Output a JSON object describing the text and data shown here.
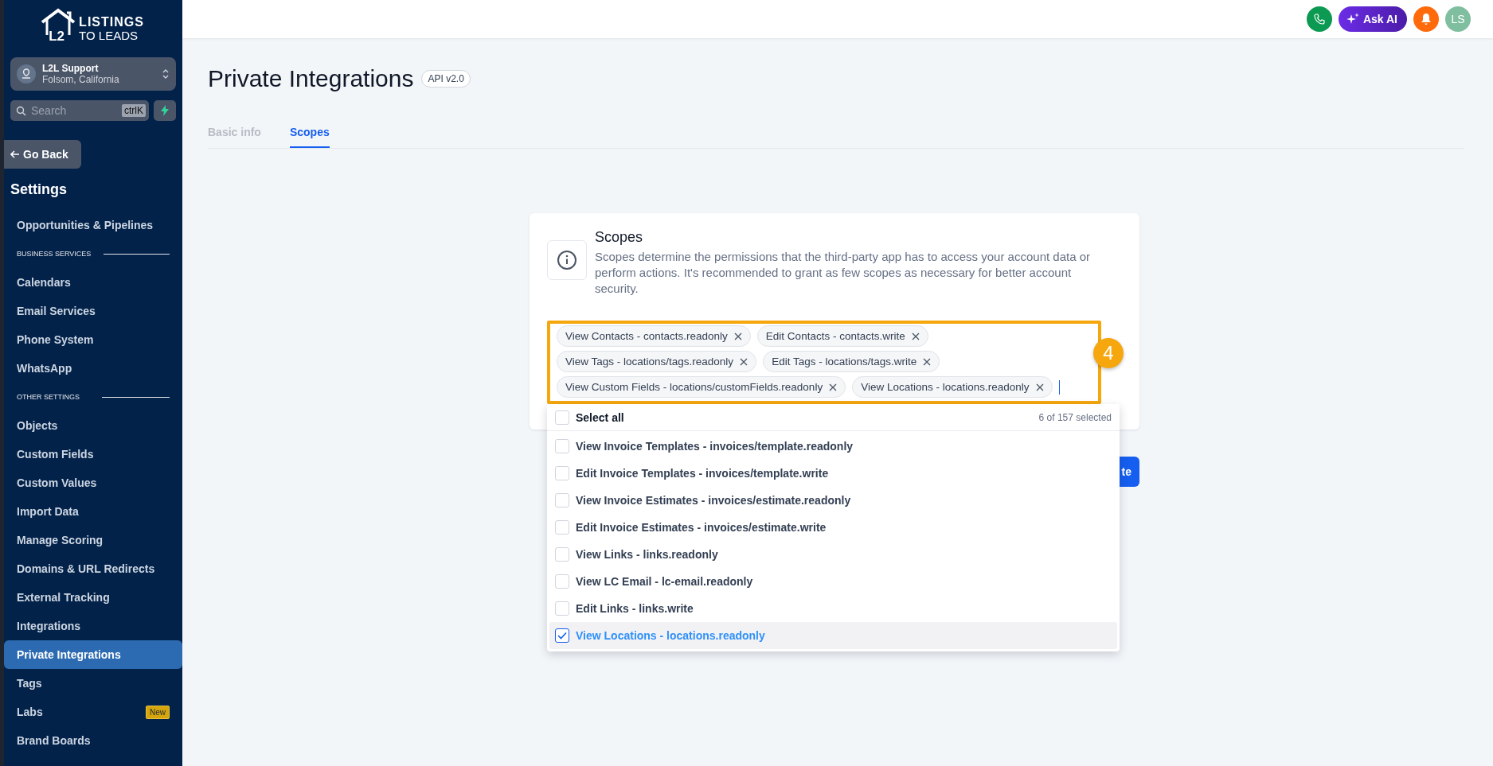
{
  "sidebar": {
    "logo": {
      "mark": "L2",
      "line1": "LISTINGS",
      "line2": "TO LEADS"
    },
    "account": {
      "name": "L2L Support",
      "location": "Folsom, California"
    },
    "search": {
      "placeholder": "Search",
      "shortcut": "ctrlK"
    },
    "back_button": "Go Back",
    "section_title": "Settings",
    "nav": [
      {
        "kind": "link",
        "label": "Opportunities & Pipelines",
        "selected": false
      },
      {
        "kind": "heading",
        "label": "BUSINESS SERVICES"
      },
      {
        "kind": "link",
        "label": "Calendars",
        "selected": false
      },
      {
        "kind": "link",
        "label": "Email Services",
        "selected": false
      },
      {
        "kind": "link",
        "label": "Phone System",
        "selected": false
      },
      {
        "kind": "link",
        "label": "WhatsApp",
        "selected": false
      },
      {
        "kind": "heading",
        "label": "OTHER SETTINGS"
      },
      {
        "kind": "link",
        "label": "Objects",
        "selected": false
      },
      {
        "kind": "link",
        "label": "Custom Fields",
        "selected": false
      },
      {
        "kind": "link",
        "label": "Custom Values",
        "selected": false
      },
      {
        "kind": "link",
        "label": "Import Data",
        "selected": false
      },
      {
        "kind": "link",
        "label": "Manage Scoring",
        "selected": false
      },
      {
        "kind": "link",
        "label": "Domains & URL Redirects",
        "selected": false
      },
      {
        "kind": "link",
        "label": "External Tracking",
        "selected": false
      },
      {
        "kind": "link",
        "label": "Integrations",
        "selected": false
      },
      {
        "kind": "link",
        "label": "Private Integrations",
        "selected": true
      },
      {
        "kind": "link",
        "label": "Tags",
        "selected": false
      },
      {
        "kind": "link",
        "label": "Labs",
        "selected": false,
        "badge": "New"
      },
      {
        "kind": "link",
        "label": "Brand Boards",
        "selected": false
      }
    ]
  },
  "topbar": {
    "ask_ai": "Ask AI",
    "avatar": "LS"
  },
  "page": {
    "title": "Private Integrations",
    "api_badge": "API v2.0",
    "tabs": [
      {
        "label": "Basic info",
        "selected": false
      },
      {
        "label": "Scopes",
        "selected": true
      }
    ]
  },
  "card": {
    "title": "Scopes",
    "description": "Scopes determine the permissions that the third-party app has to access your account data or perform actions. It's recommended to grant as few scopes as necessary for better account security.",
    "tags": [
      {
        "label": "View Contacts - contacts.readonly"
      },
      {
        "label": "Edit Contacts - contacts.write"
      },
      {
        "label": "View Tags - locations/tags.readonly"
      },
      {
        "label": "Edit Tags - locations/tags.write"
      },
      {
        "label": "View Custom Fields - locations/customFields.readonly"
      },
      {
        "label": "View Locations - locations.readonly"
      }
    ],
    "step_marker": "4",
    "dropdown": {
      "select_all": {
        "label": "Select all",
        "checked": false
      },
      "count": "6 of 157 selected",
      "options": [
        {
          "label": "View Invoice Templates - invoices/template.readonly",
          "checked": false,
          "selected": false
        },
        {
          "label": "Edit Invoice Templates - invoices/template.write",
          "checked": false,
          "selected": false
        },
        {
          "label": "View Invoice Estimates - invoices/estimate.readonly",
          "checked": false,
          "selected": false
        },
        {
          "label": "Edit Invoice Estimates - invoices/estimate.write",
          "checked": false,
          "selected": false
        },
        {
          "label": "View Links - links.readonly",
          "checked": false,
          "selected": false
        },
        {
          "label": "View LC Email - lc-email.readonly",
          "checked": false,
          "selected": false
        },
        {
          "label": "Edit Links - links.write",
          "checked": false,
          "selected": false
        },
        {
          "label": "View Locations - locations.readonly",
          "checked": true,
          "selected": true
        }
      ]
    },
    "action_button": "te"
  }
}
